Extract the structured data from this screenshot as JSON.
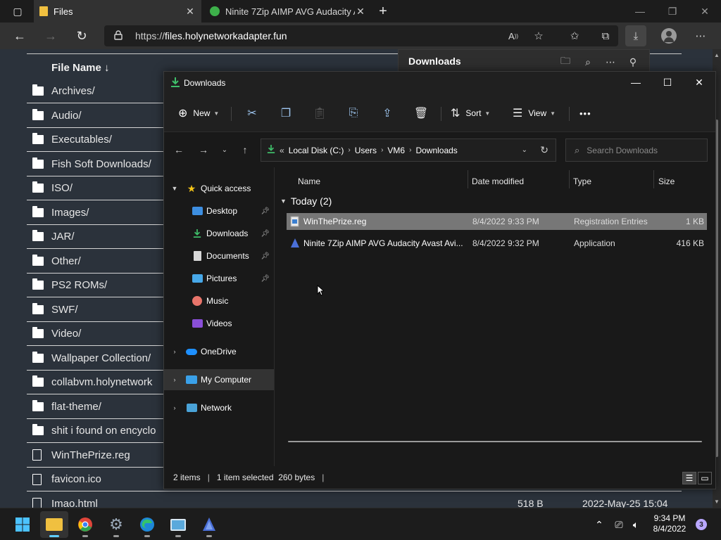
{
  "browser": {
    "tabs": [
      {
        "title": "Files",
        "close": "✕"
      },
      {
        "title": "Ninite 7Zip AIMP AVG Audacity A",
        "close": "✕"
      }
    ],
    "new_tab": "+",
    "address": {
      "scheme": "https://",
      "host": "files.holynetworkadapter.fun"
    }
  },
  "page": {
    "header": "File Name ↓",
    "rows": [
      {
        "name": "Archives/",
        "kind": "folder",
        "size": "",
        "date": ""
      },
      {
        "name": "Audio/",
        "kind": "folder",
        "size": "",
        "date": ""
      },
      {
        "name": "Executables/",
        "kind": "folder",
        "size": "",
        "date": ""
      },
      {
        "name": "Fish Soft Downloads/",
        "kind": "folder",
        "size": "",
        "date": ""
      },
      {
        "name": "ISO/",
        "kind": "folder",
        "size": "",
        "date": ""
      },
      {
        "name": "Images/",
        "kind": "folder",
        "size": "",
        "date": ""
      },
      {
        "name": "JAR/",
        "kind": "folder",
        "size": "",
        "date": ""
      },
      {
        "name": "Other/",
        "kind": "folder",
        "size": "",
        "date": ""
      },
      {
        "name": "PS2 ROMs/",
        "kind": "folder",
        "size": "",
        "date": ""
      },
      {
        "name": "SWF/",
        "kind": "folder",
        "size": "",
        "date": ""
      },
      {
        "name": "Video/",
        "kind": "folder",
        "size": "",
        "date": ""
      },
      {
        "name": "Wallpaper Collection/",
        "kind": "folder",
        "size": "",
        "date": ""
      },
      {
        "name": "collabvm.holynetwork",
        "kind": "folder",
        "size": "",
        "date": ""
      },
      {
        "name": "flat-theme/",
        "kind": "folder",
        "size": "",
        "date": ""
      },
      {
        "name": "shit i found on encyclo",
        "kind": "folder",
        "size": "",
        "date": ""
      },
      {
        "name": "WinThePrize.reg",
        "kind": "file",
        "size": "",
        "date": ""
      },
      {
        "name": "favicon.ico",
        "kind": "file",
        "size": "",
        "date": ""
      },
      {
        "name": "Imao.html",
        "kind": "file",
        "size": "518 B",
        "date": "2022-May-25 15:04"
      }
    ]
  },
  "downloads_flyout": {
    "title": "Downloads"
  },
  "explorer": {
    "title": "Downloads",
    "cmd": {
      "new": "New",
      "sort": "Sort",
      "view": "View",
      "more": "•••"
    },
    "breadcrumb": [
      "Local Disk (C:)",
      "Users",
      "VM6",
      "Downloads"
    ],
    "breadcrumb_prefix": "«",
    "search_placeholder": "Search Downloads",
    "nav": {
      "quick_access": "Quick access",
      "items": [
        "Desktop",
        "Downloads",
        "Documents",
        "Pictures",
        "Music",
        "Videos"
      ],
      "onedrive": "OneDrive",
      "my_computer": "My Computer",
      "network": "Network"
    },
    "columns": {
      "name": "Name",
      "date": "Date modified",
      "type": "Type",
      "size": "Size"
    },
    "group": "Today (2)",
    "files": [
      {
        "name": "WinThePrize.reg",
        "date": "8/4/2022 9:33 PM",
        "type": "Registration Entries",
        "size": "1 KB"
      },
      {
        "name": "Ninite 7Zip AIMP AVG Audacity Avast Avi...",
        "date": "8/4/2022 9:32 PM",
        "type": "Application",
        "size": "416 KB"
      }
    ],
    "status": {
      "count": "2 items",
      "selection": "1 item selected  260 bytes",
      "sep": "|"
    }
  },
  "taskbar": {
    "clock_time": "9:34 PM",
    "clock_date": "8/4/2022",
    "notifications": "3"
  },
  "colors": {
    "accent": "#60cdff",
    "folder_yellow": "#f0c040",
    "selection": "#777777"
  }
}
